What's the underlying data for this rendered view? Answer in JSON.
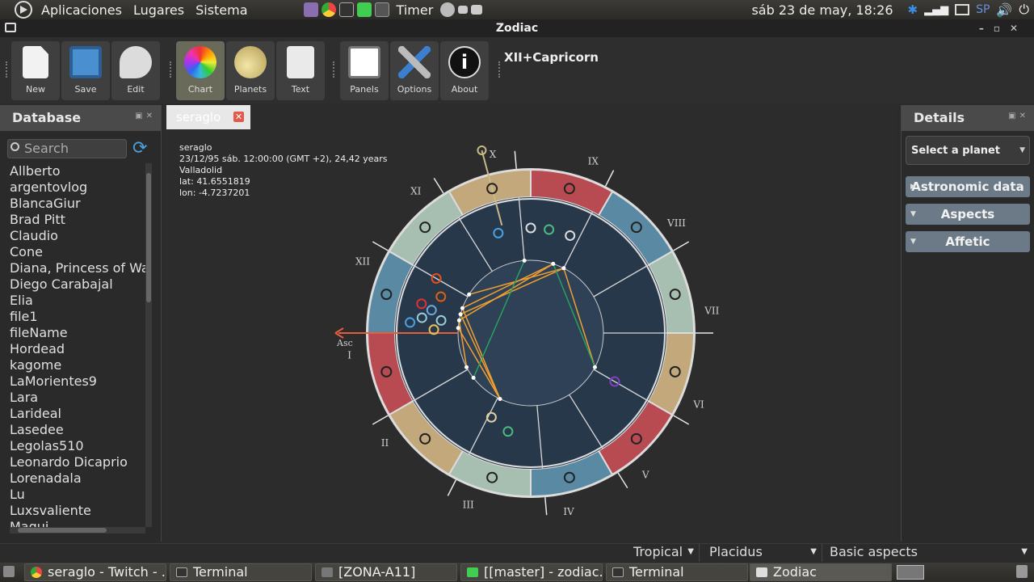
{
  "top_panel": {
    "menus": [
      "Aplicaciones",
      "Lugares",
      "Sistema"
    ],
    "timer_label": "Timer",
    "keyboard_layout": "SP",
    "clock": "sáb 23 de may, 18:26"
  },
  "window": {
    "title": "Zodiac"
  },
  "toolbar": {
    "buttons": [
      "New",
      "Save",
      "Edit",
      "Chart",
      "Planets",
      "Text",
      "Panels",
      "Options",
      "About"
    ],
    "context_label": "XII+Capricorn"
  },
  "database": {
    "title": "Database",
    "search_placeholder": "Search",
    "items": [
      "Allberto",
      "argentovlog",
      "BlancaGiur",
      "Brad Pitt",
      "Claudio",
      "Cone",
      "Diana, Princess of Wale",
      "Diego Carabajal",
      "Elia",
      "file1",
      "fileName",
      "Hordead",
      "kagome",
      "LaMorientes9",
      "Lara",
      "Larideal",
      "Lasedee",
      "Legolas510",
      "Leonardo Dicaprio",
      "Lorenadala",
      "Lu",
      "Luxsvaliente",
      "Magui"
    ]
  },
  "tab": {
    "label": "seraglo"
  },
  "chart_info": {
    "name": "seraglo",
    "datetime": "23/12/95 sáb. 12:00:00 (GMT +2), 24,42 years",
    "place": "Valladolid",
    "lat": "lat: 41.6551819",
    "lon": "lon: -4.7237201"
  },
  "chart": {
    "houses": [
      "I",
      "II",
      "III",
      "IV",
      "V",
      "VI",
      "VII",
      "VIII",
      "IX",
      "X",
      "XI",
      "XII"
    ],
    "asc_label": "Asc",
    "sign_colors": {
      "fire": "#b84a52",
      "earth": "#c2a87a",
      "air": "#a7bfb0",
      "water": "#5a8aa3"
    }
  },
  "details": {
    "title": "Details",
    "select_placeholder": "Select a planet",
    "sections": [
      "Astronomic data",
      "Aspects",
      "Affetic"
    ]
  },
  "status": {
    "zodiac": "Tropical",
    "houses": "Placidus",
    "aspects": "Basic aspects"
  },
  "taskbar": {
    "tasks": [
      "seraglo - Twitch - ...",
      "Terminal",
      "[ZONA-A11]",
      "[[master] - zodiac...",
      "Terminal",
      "Zodiac"
    ]
  }
}
